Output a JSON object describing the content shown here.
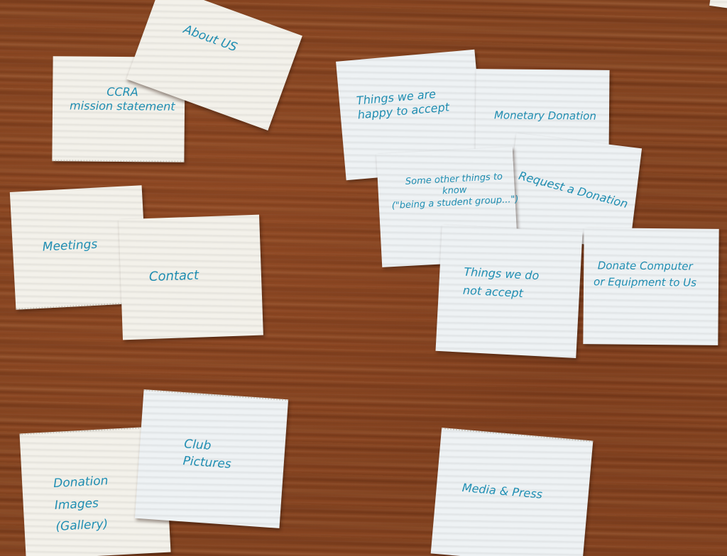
{
  "cards": {
    "mission": "CCRA\nmission statement",
    "about": "About US",
    "meetings": "Meetings",
    "contact": "Contact",
    "things_accept": "Things we are\nhappy to accept",
    "monetary": "Monetary Donation",
    "other_things": "Some other things to\nknow\n(\"being a student group...\")",
    "request": "Request a Donation",
    "not_accept": "Things we do\nnot accept",
    "donate_computer": "Donate Computer\nor Equipment to Us",
    "donation_images": "Donation\nImages\n(Gallery)",
    "club_pictures": "Club\nPictures",
    "media_press": "Media & Press"
  },
  "colors": {
    "ink": "#1e8fb4",
    "table": "#82421f",
    "paper": "#f3f1ea"
  }
}
